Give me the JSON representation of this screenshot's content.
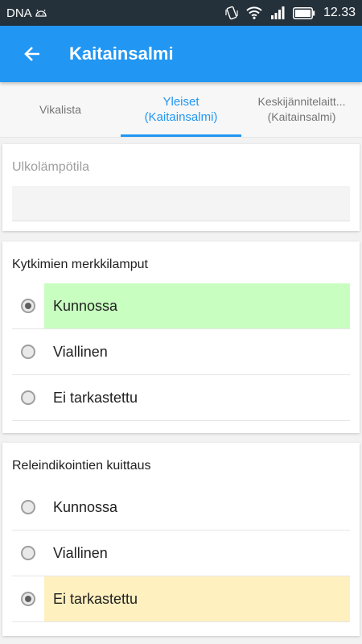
{
  "status_bar": {
    "carrier": "DNA",
    "time": "12.33",
    "icons": [
      "android-icon",
      "vibrate-icon",
      "wifi-icon",
      "signal-icon",
      "battery-icon"
    ]
  },
  "app_bar": {
    "title": "Kaitainsalmi",
    "back_icon": "arrow-left-icon",
    "color": "#2196f3"
  },
  "tabs": [
    {
      "line1": "Vikalista",
      "line2": "",
      "active": false
    },
    {
      "line1": "Yleiset",
      "line2": "(Kaitainsalmi)",
      "active": true
    },
    {
      "line1": "Keskijännitelaitt...",
      "line2": "(Kaitainsalmi)",
      "active": false
    }
  ],
  "outdoor_temp": {
    "label": "Ulkolämpötila",
    "value": ""
  },
  "groups": [
    {
      "title": "Kytkimien merkkilamput",
      "options": [
        "Kunnossa",
        "Viallinen",
        "Ei tarkastettu"
      ],
      "selected_index": 0,
      "highlight_color": "#c8ffc0"
    },
    {
      "title": "Releindikointien kuittaus",
      "options": [
        "Kunnossa",
        "Viallinen",
        "Ei tarkastettu"
      ],
      "selected_index": 2,
      "highlight_color": "#fff0c0"
    }
  ]
}
